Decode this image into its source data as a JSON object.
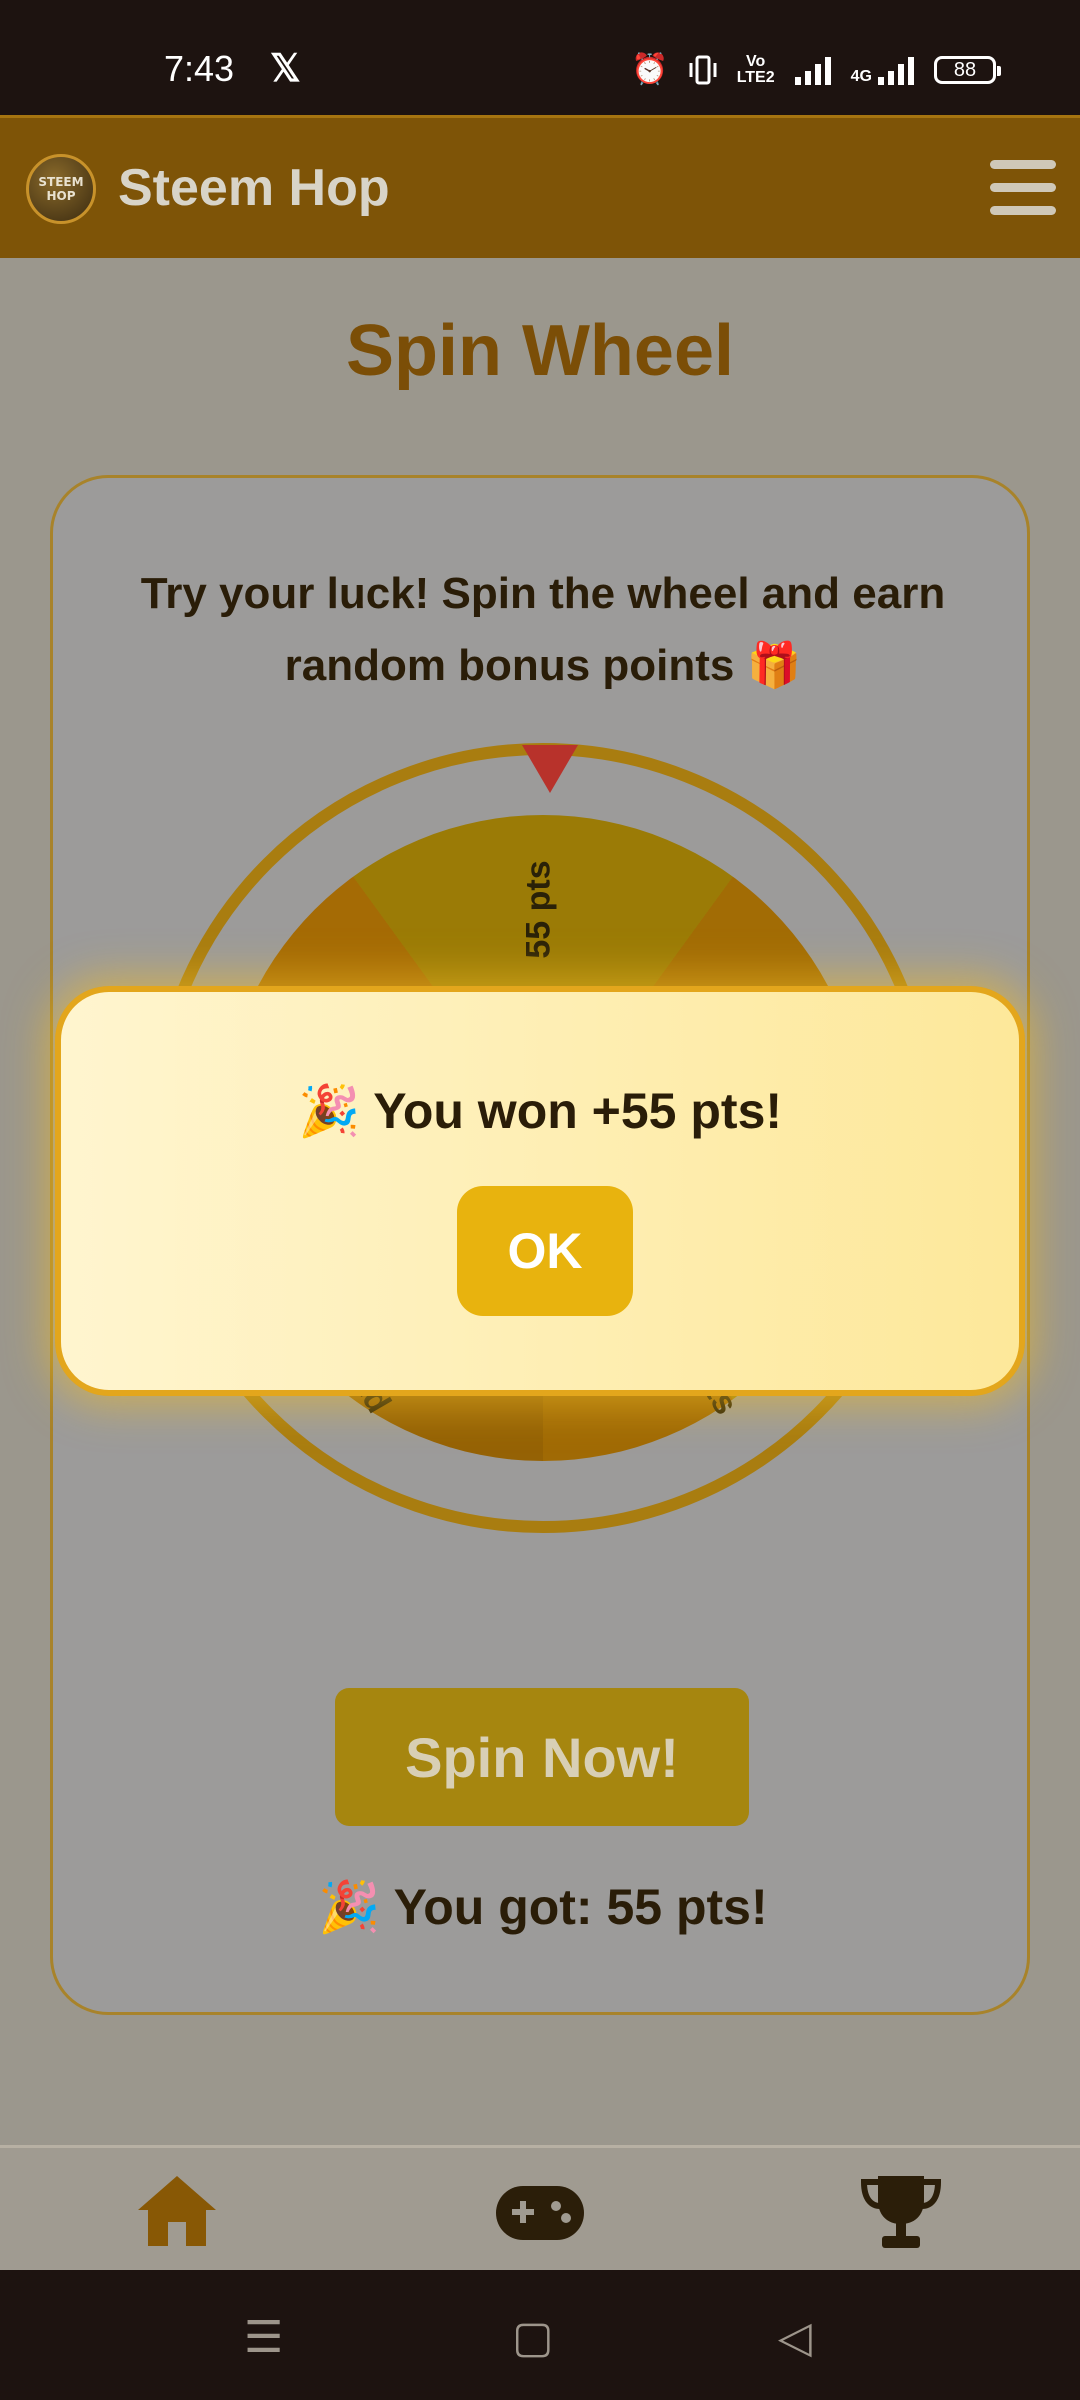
{
  "status_bar": {
    "time": "7:43",
    "x_icon_label": "𝕏",
    "volte_label": "Vo LTE2",
    "network_label": "4G",
    "battery": "88"
  },
  "header": {
    "logo_text": "STEEM HOP",
    "title": "Steem Hop",
    "menu_icon": "hamburger-icon"
  },
  "page": {
    "title": "Spin Wheel",
    "description": "Try your luck! Spin the wheel and earn random bonus points 🎁",
    "wheel_labels": [
      "55 pts",
      "pts",
      "pts"
    ],
    "spin_button": "Spin Now!",
    "result_text": "🎉 You got: 55 pts!"
  },
  "modal": {
    "message": "🎉 You won +55 pts!",
    "ok_label": "OK"
  },
  "bottom_nav": {
    "items": [
      {
        "name": "home",
        "icon": "home-icon"
      },
      {
        "name": "games",
        "icon": "gamepad-icon"
      },
      {
        "name": "leaderboard",
        "icon": "trophy-icon"
      }
    ]
  },
  "system_nav": {
    "recent": "☰",
    "home": "▢",
    "back": "◁"
  },
  "colors": {
    "header_bg": "#7e5407",
    "accent": "#e8b30e",
    "modal_border": "#e3a61c",
    "title": "#7b4e07"
  }
}
